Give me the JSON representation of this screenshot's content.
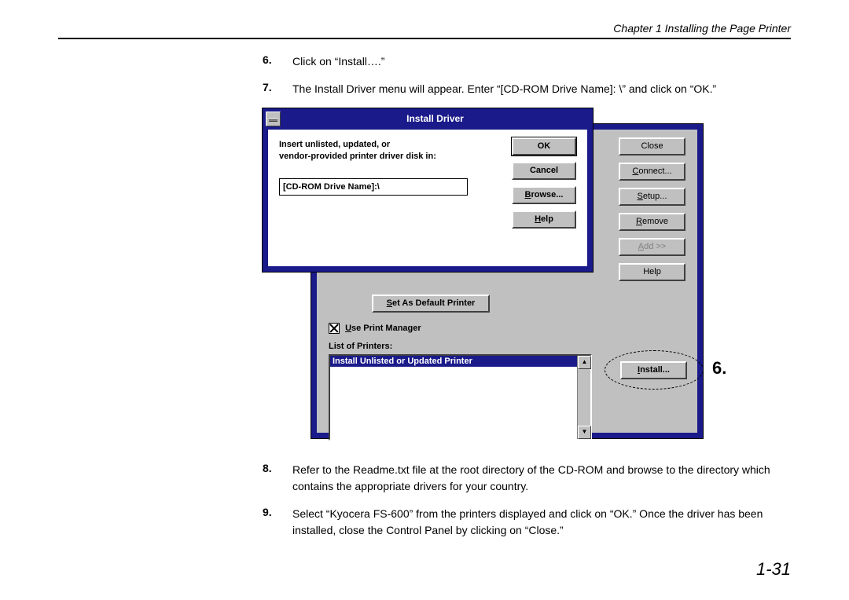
{
  "header": "Chapter 1  Installing the Page Printer",
  "steps": {
    "s6": {
      "num": "6.",
      "text": "Click on “Install….”"
    },
    "s7": {
      "num": "7.",
      "text": "The Install Driver menu will appear.  Enter “[CD-ROM Drive Name]: \\” and click on “OK.”"
    },
    "s8": {
      "num": "8.",
      "text": "Refer to the Readme.txt file at the root directory of the CD-ROM and browse to the directory which contains the appropriate drivers for your country."
    },
    "s9": {
      "num": "9.",
      "text": "Select “Kyocera FS-600” from the printers displayed and click on “OK.” Once the driver has been installed, close the Control Panel by clicking on “Close.”"
    }
  },
  "dialog": {
    "title": "Install Driver",
    "prompt_l1": "Insert unlisted, updated, or",
    "prompt_l2": "vendor-provided printer driver disk in:",
    "input_value": "[CD-ROM Drive Name]:\\",
    "buttons": {
      "ok": "OK",
      "cancel": "Cancel",
      "browse": "Browse...",
      "help": "Help"
    }
  },
  "printers": {
    "default_btn": "Set As Default Printer",
    "use_pm_pre": "U",
    "use_pm_rest": "se Print Manager",
    "list_label": "List of Printers:",
    "list_item": "Install Unlisted or Updated Printer",
    "side": {
      "close": "Close",
      "connect_pre": "C",
      "connect_rest": "onnect...",
      "setup_pre": "S",
      "setup_rest": "etup...",
      "remove_pre": "R",
      "remove_rest": "emove",
      "add_pre": "A",
      "add_rest": "dd >>",
      "help": "Help",
      "install_pre": "I",
      "install_rest": "nstall..."
    }
  },
  "callout_num": "6.",
  "page_num": "1-31",
  "arrows": {
    "up": "▲",
    "down": "▼"
  }
}
